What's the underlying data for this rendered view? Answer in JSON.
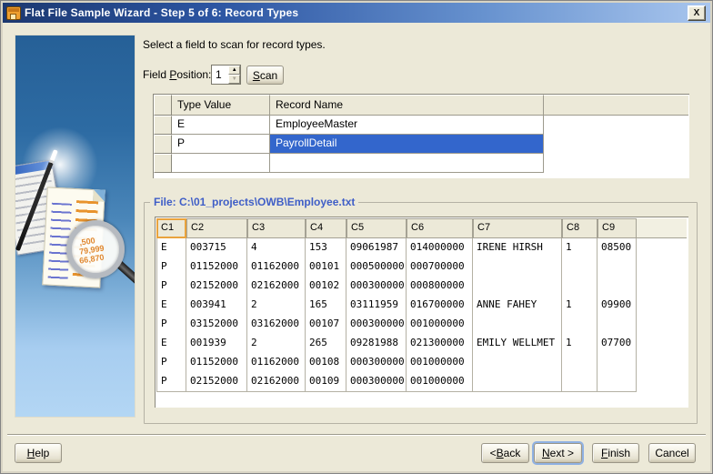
{
  "window": {
    "title": "Flat File Sample Wizard - Step 5 of 6: Record Types"
  },
  "icons": {
    "close": "X",
    "spinner_up": "▲",
    "spinner_down": "▼"
  },
  "instruction": "Select a field to scan for record types.",
  "field_position": {
    "label": "Field Position:",
    "mnemonic": "P",
    "value": "1"
  },
  "scan_button": {
    "label": "Scan",
    "mnemonic": "S"
  },
  "record_types": {
    "columns": [
      "Type Value",
      "Record Name"
    ],
    "rows": [
      {
        "type_value": "E",
        "record_name": "EmployeeMaster",
        "selected": false
      },
      {
        "type_value": "P",
        "record_name": "PayrollDetail",
        "selected": true
      },
      {
        "type_value": "",
        "record_name": "",
        "selected": false
      }
    ]
  },
  "file_group": {
    "legend": "File: C:\\01_projects\\OWB\\Employee.txt"
  },
  "data_table": {
    "columns": [
      "C1",
      "C2",
      "C3",
      "C4",
      "C5",
      "C6",
      "C7",
      "C8",
      "C9"
    ],
    "rows": [
      [
        "E",
        "003715",
        "4",
        "153",
        "09061987",
        "014000000",
        "IRENE HIRSH",
        "1",
        "08500"
      ],
      [
        "P",
        "01152000",
        "01162000",
        "00101",
        "000500000",
        "000700000",
        "",
        "",
        ""
      ],
      [
        "P",
        "02152000",
        "02162000",
        "00102",
        "000300000",
        "000800000",
        "",
        "",
        ""
      ],
      [
        "E",
        "003941",
        "2",
        "165",
        "03111959",
        "016700000",
        "ANNE FAHEY",
        "1",
        "09900"
      ],
      [
        "P",
        "03152000",
        "03162000",
        "00107",
        "000300000",
        "001000000",
        "",
        "",
        ""
      ],
      [
        "E",
        "001939",
        "2",
        "265",
        "09281988",
        "021300000",
        "EMILY WELLMET",
        "1",
        "07700"
      ],
      [
        "P",
        "01152000",
        "01162000",
        "00108",
        "000300000",
        "001000000",
        "",
        "",
        ""
      ],
      [
        "P",
        "02152000",
        "02162000",
        "00109",
        "000300000",
        "001000000",
        "",
        "",
        ""
      ]
    ]
  },
  "buttons": {
    "help": {
      "label": "Help",
      "mnemonic": "H"
    },
    "back": {
      "label": "< Back",
      "mnemonic": "B"
    },
    "next": {
      "label": "Next >",
      "mnemonic": "N"
    },
    "finish": {
      "label": "Finish",
      "mnemonic": "F"
    },
    "cancel": {
      "label": "Cancel",
      "mnemonic": ""
    }
  },
  "sidebar": {
    "magnifier_values": [
      ",500",
      "79,999",
      "66,870"
    ]
  },
  "colors": {
    "selection": "#3366cc",
    "titlebar_left": "#1c3870",
    "titlebar_right": "#a9c6ee",
    "legend_blue": "#3f5ec7",
    "focus_orange": "#e9a33d",
    "dialog_bg": "#ece9d8"
  }
}
